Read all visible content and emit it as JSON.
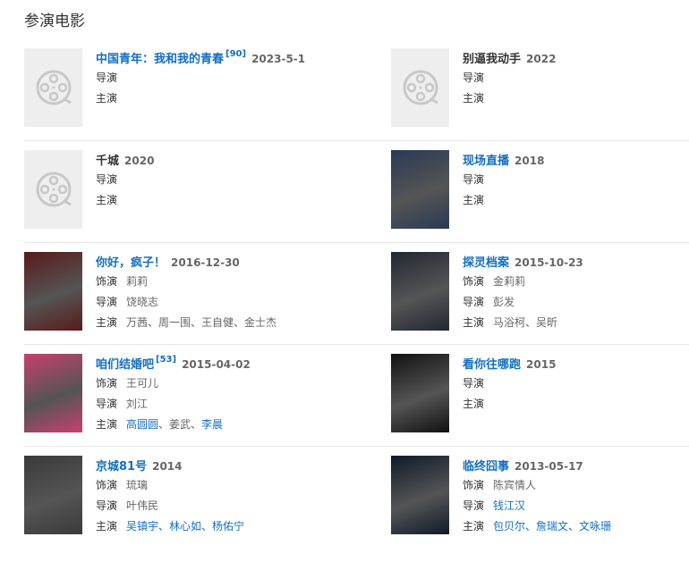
{
  "section_title": "参演电影",
  "films": [
    {
      "title": "中国青年：我和我的青春",
      "sup": "[90]",
      "year": "2023-5-1",
      "title_link": true,
      "poster": "placeholder",
      "lines": [
        {
          "label": "导演",
          "values": []
        },
        {
          "label": "主演",
          "values": []
        }
      ]
    },
    {
      "title": "别逼我动手",
      "sup": "",
      "year": "2022",
      "title_link": false,
      "poster": "placeholder",
      "lines": [
        {
          "label": "导演",
          "values": []
        },
        {
          "label": "主演",
          "values": []
        }
      ]
    },
    {
      "title": "千城",
      "sup": "",
      "year": "2020",
      "title_link": false,
      "poster": "placeholder",
      "lines": [
        {
          "label": "导演",
          "values": []
        },
        {
          "label": "主演",
          "values": []
        }
      ]
    },
    {
      "title": "现场直播",
      "sup": "",
      "year": "2018",
      "title_link": true,
      "poster": "image",
      "lines": [
        {
          "label": "导演",
          "values": []
        },
        {
          "label": "主演",
          "values": []
        }
      ]
    },
    {
      "title": "你好，疯子！",
      "sup": "",
      "year": "2016-12-30",
      "title_link": true,
      "poster": "image",
      "lines": [
        {
          "label": "饰演",
          "values": [
            {
              "t": "莉莉",
              "link": false
            }
          ]
        },
        {
          "label": "导演",
          "values": [
            {
              "t": "饶晓志",
              "link": false
            }
          ]
        },
        {
          "label": "主演",
          "values": [
            {
              "t": "万茜、周一围、王自健、金士杰",
              "link": false
            }
          ]
        }
      ]
    },
    {
      "title": "探灵档案",
      "sup": "",
      "year": "2015-10-23",
      "title_link": true,
      "poster": "image",
      "lines": [
        {
          "label": "饰演",
          "values": [
            {
              "t": "金莉莉",
              "link": false
            }
          ]
        },
        {
          "label": "导演",
          "values": [
            {
              "t": "彭发",
              "link": false
            }
          ]
        },
        {
          "label": "主演",
          "values": [
            {
              "t": "马浴柯、吴昕",
              "link": false
            }
          ]
        }
      ]
    },
    {
      "title": "咱们结婚吧",
      "sup": "[53]",
      "year": "2015-04-02",
      "title_link": true,
      "poster": "image",
      "lines": [
        {
          "label": "饰演",
          "values": [
            {
              "t": "王可儿",
              "link": false
            }
          ]
        },
        {
          "label": "导演",
          "values": [
            {
              "t": "刘江",
              "link": false
            }
          ]
        },
        {
          "label": "主演",
          "values": [
            {
              "t": "高圆圆",
              "link": true
            },
            {
              "t": "、姜武、",
              "link": false
            },
            {
              "t": "李晨",
              "link": true
            }
          ]
        }
      ]
    },
    {
      "title": "看你往哪跑",
      "sup": "",
      "year": "2015",
      "title_link": true,
      "poster": "image",
      "lines": [
        {
          "label": "导演",
          "values": []
        },
        {
          "label": "主演",
          "values": []
        }
      ]
    },
    {
      "title": "京城81号",
      "sup": "",
      "year": "2014",
      "title_link": true,
      "poster": "image",
      "lines": [
        {
          "label": "饰演",
          "values": [
            {
              "t": "琉璃",
              "link": false
            }
          ]
        },
        {
          "label": "导演",
          "values": [
            {
              "t": "叶伟民",
              "link": false
            }
          ]
        },
        {
          "label": "主演",
          "values": [
            {
              "t": "吴镇宇、林心如、杨佑宁",
              "link": true
            }
          ]
        }
      ]
    },
    {
      "title": "临终囧事",
      "sup": "",
      "year": "2013-05-17",
      "title_link": true,
      "poster": "image",
      "lines": [
        {
          "label": "饰演",
          "values": [
            {
              "t": "陈宾情人",
              "link": false
            }
          ]
        },
        {
          "label": "导演",
          "values": [
            {
              "t": "钱江汉",
              "link": true
            }
          ]
        },
        {
          "label": "主演",
          "values": [
            {
              "t": "包贝尔、詹瑞文、文咏珊",
              "link": true
            }
          ]
        }
      ]
    }
  ],
  "poster_colors": [
    "#2a3a55",
    "#5a1a1a",
    "#222831",
    "#c7406f",
    "#111111",
    "#3a3a3a",
    "#0f1a2a"
  ],
  "link_color": "#136ec2"
}
